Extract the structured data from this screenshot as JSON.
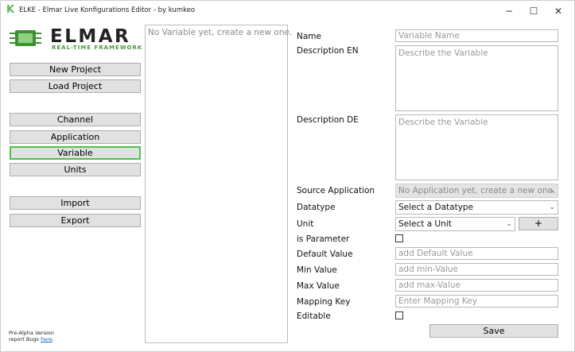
{
  "window": {
    "title": "ELKE - Elmar Live Konfigurations Editor - by kumkeo",
    "app_icon_glyph": "K",
    "minimize_glyph": "−",
    "maximize_glyph": "☐",
    "close_glyph": "✕"
  },
  "logo": {
    "wordmark": "ELMAR",
    "tagline": "REAL-TIME FRAMEWORK",
    "accent_color": "#4a9a3c"
  },
  "sidebar": {
    "new_project": "New Project",
    "load_project": "Load Project",
    "channel": "Channel",
    "application": "Application",
    "variable": "Variable",
    "units": "Units",
    "import": "Import",
    "export": "Export",
    "active_item": "Variable"
  },
  "footer": {
    "line1": "Pre-Alpha Version",
    "line2_prefix": "report Bugs ",
    "line2_link": "here",
    "line2_suffix": "."
  },
  "variable_list": {
    "empty_text": "No Variable yet, create a new one."
  },
  "form": {
    "name_label": "Name",
    "name_placeholder": "Variable Name",
    "desc_en_label": "Description EN",
    "desc_en_placeholder": "Describe the Variable",
    "desc_de_label": "Description DE",
    "desc_de_placeholder": "Describe the Variable",
    "source_app_label": "Source Application",
    "source_app_value": "No Application yet, create a new one.",
    "datatype_label": "Datatype",
    "datatype_value": "Select a Datatype",
    "unit_label": "Unit",
    "unit_value": "Select a Unit",
    "add_unit_label": "+",
    "is_parameter_label": "is Parameter",
    "default_label": "Default Value",
    "default_placeholder": "add Default Value",
    "min_label": "Min Value",
    "min_placeholder": "add min-Value",
    "max_label": "Max Value",
    "max_placeholder": "add max-Value",
    "mapping_label": "Mapping Key",
    "mapping_placeholder": "Enter Mapping Key",
    "editable_label": "Editable",
    "save_label": "Save"
  }
}
